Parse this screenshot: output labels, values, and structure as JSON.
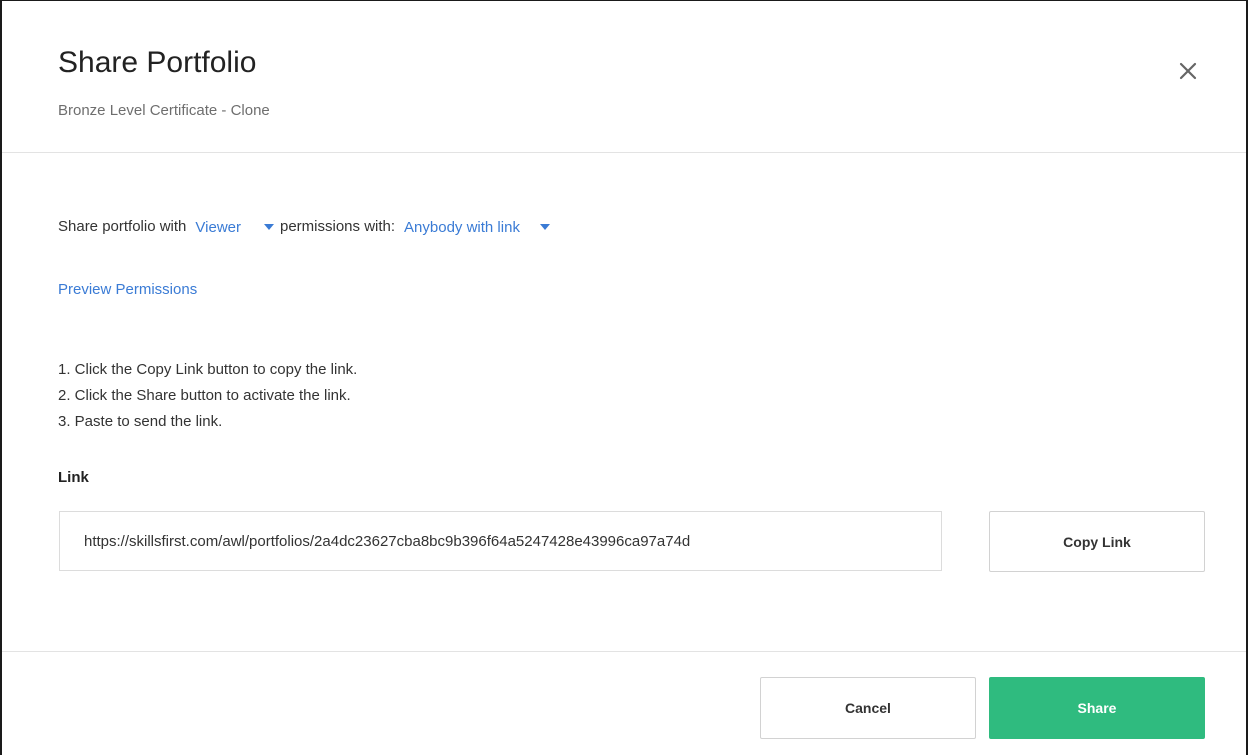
{
  "modal": {
    "title": "Share Portfolio",
    "subtitle": "Bronze Level Certificate - Clone",
    "close_icon": "close-icon"
  },
  "permissions": {
    "prefix": "Share portfolio with",
    "role_value": "Viewer",
    "middle": "permissions with:",
    "audience_value": "Anybody with link",
    "caret_icon": "caret-down-icon"
  },
  "preview_link": "Preview Permissions",
  "instructions": [
    "1. Click the Copy Link button to copy the link.",
    "2. Click the Share button to activate the link.",
    "3. Paste to send the link."
  ],
  "link_field": {
    "label": "Link",
    "value": "https://skillsfirst.com/awl/portfolios/2a4dc23627cba8bc9b396f64a5247428e43996ca97a74d"
  },
  "buttons": {
    "copy_link": "Copy Link",
    "cancel": "Cancel",
    "share": "Share"
  },
  "colors": {
    "accent": "#3a7bd5",
    "primary": "#2fbb7f"
  }
}
